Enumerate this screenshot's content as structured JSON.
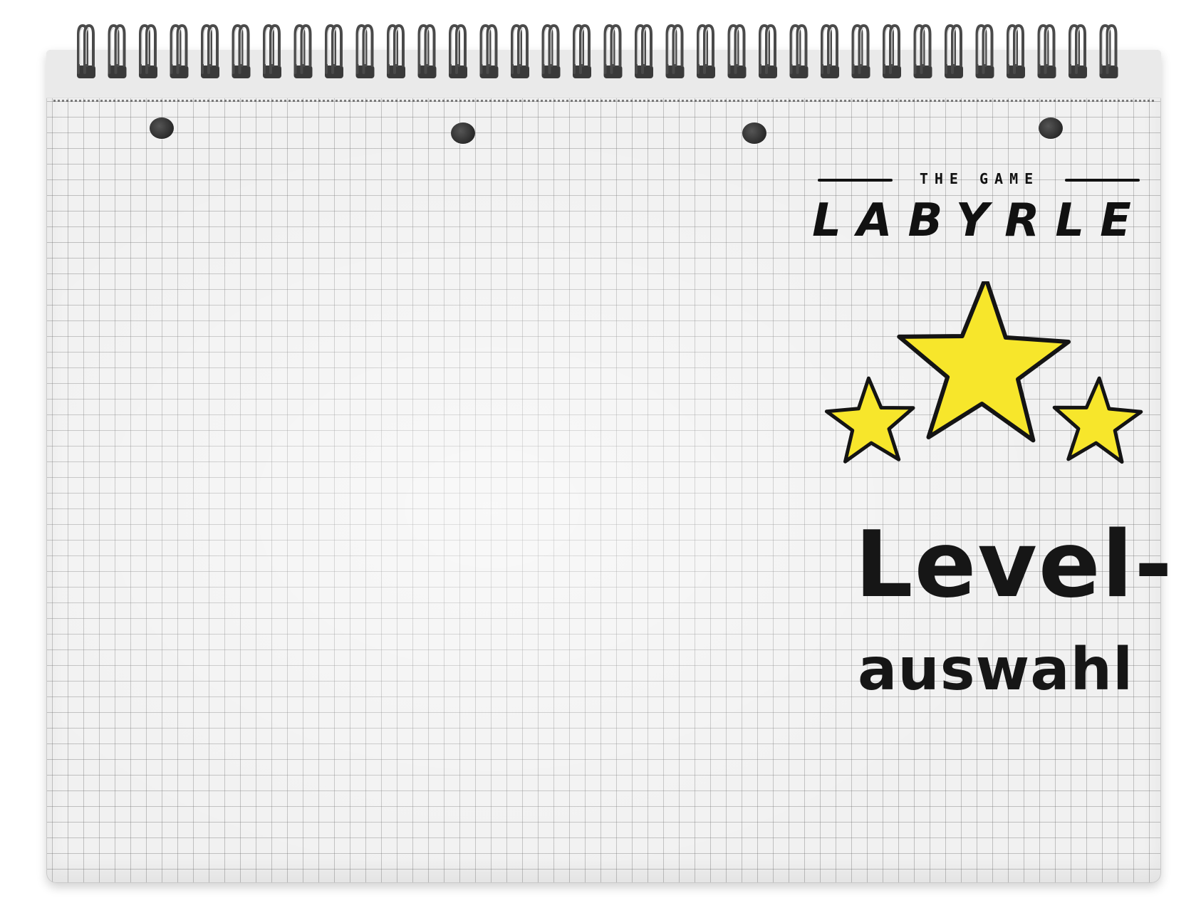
{
  "game": {
    "logo": {
      "subtitle": "THE GAME",
      "title": "LABYRLE"
    },
    "screen_title": {
      "line1": "Level-",
      "line2": "auswahl"
    },
    "stars": {
      "earned": 3,
      "total": 3,
      "fill_color": "#f7e62b",
      "stroke_color": "#141414"
    },
    "colors": {
      "paper": "#f1f1f1",
      "grid": "#6e6e6e",
      "ink": "#111111",
      "accent": "#f7e62b"
    }
  }
}
